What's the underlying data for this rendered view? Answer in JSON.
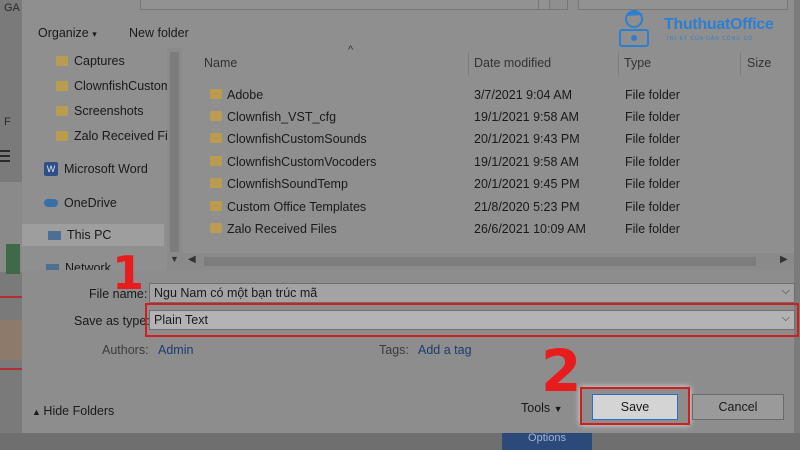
{
  "toolbar": {
    "organize": "Organize",
    "new_folder": "New folder"
  },
  "nav": {
    "items": [
      {
        "label": "Captures",
        "type": "folder"
      },
      {
        "label": "ClownfishCustom",
        "type": "folder"
      },
      {
        "label": "Screenshots",
        "type": "folder"
      },
      {
        "label": "Zalo Received Fi",
        "type": "folder"
      },
      {
        "label": "Microsoft Word",
        "type": "word"
      },
      {
        "label": "OneDrive",
        "type": "cloud"
      },
      {
        "label": "This PC",
        "type": "pc",
        "selected": true
      },
      {
        "label": "Network",
        "type": "network"
      }
    ]
  },
  "filelist": {
    "columns": [
      "Name",
      "Date modified",
      "Type",
      "Size"
    ],
    "rows": [
      {
        "name": "Adobe",
        "date": "3/7/2021 9:04 AM",
        "type": "File folder"
      },
      {
        "name": "Clownfish_VST_cfg",
        "date": "19/1/2021 9:58 AM",
        "type": "File folder"
      },
      {
        "name": "ClownfishCustomSounds",
        "date": "20/1/2021 9:43 PM",
        "type": "File folder"
      },
      {
        "name": "ClownfishCustomVocoders",
        "date": "19/1/2021 9:58 AM",
        "type": "File folder"
      },
      {
        "name": "ClownfishSoundTemp",
        "date": "20/1/2021 9:45 PM",
        "type": "File folder"
      },
      {
        "name": "Custom Office Templates",
        "date": "21/8/2020 5:23 PM",
        "type": "File folder"
      },
      {
        "name": "Zalo Received Files",
        "date": "26/6/2021 10:09 AM",
        "type": "File folder"
      }
    ]
  },
  "form": {
    "file_name_label": "File name:",
    "file_name_value": "Ngu Nam có một bạn trúc mã",
    "save_as_type_label": "Save as type:",
    "save_as_type_value": "Plain Text",
    "authors_label": "Authors:",
    "authors_value": "Admin",
    "tags_label": "Tags:",
    "tags_value": "Add a tag"
  },
  "footer": {
    "hide_folders": "Hide Folders",
    "tools": "Tools",
    "save": "Save",
    "cancel": "Cancel"
  },
  "steps": [
    "1",
    "2"
  ],
  "logo": {
    "brand": "ThuthuatOffice",
    "tagline": "TRÍ KỸ CỦA DÂN CÔNG SỞ"
  },
  "background": {
    "options_label": "Options",
    "side_letter_g": "GA",
    "side_letter_f": "F"
  },
  "colors": {
    "highlight": "#d11e1e",
    "brand": "#2f7fd0"
  }
}
